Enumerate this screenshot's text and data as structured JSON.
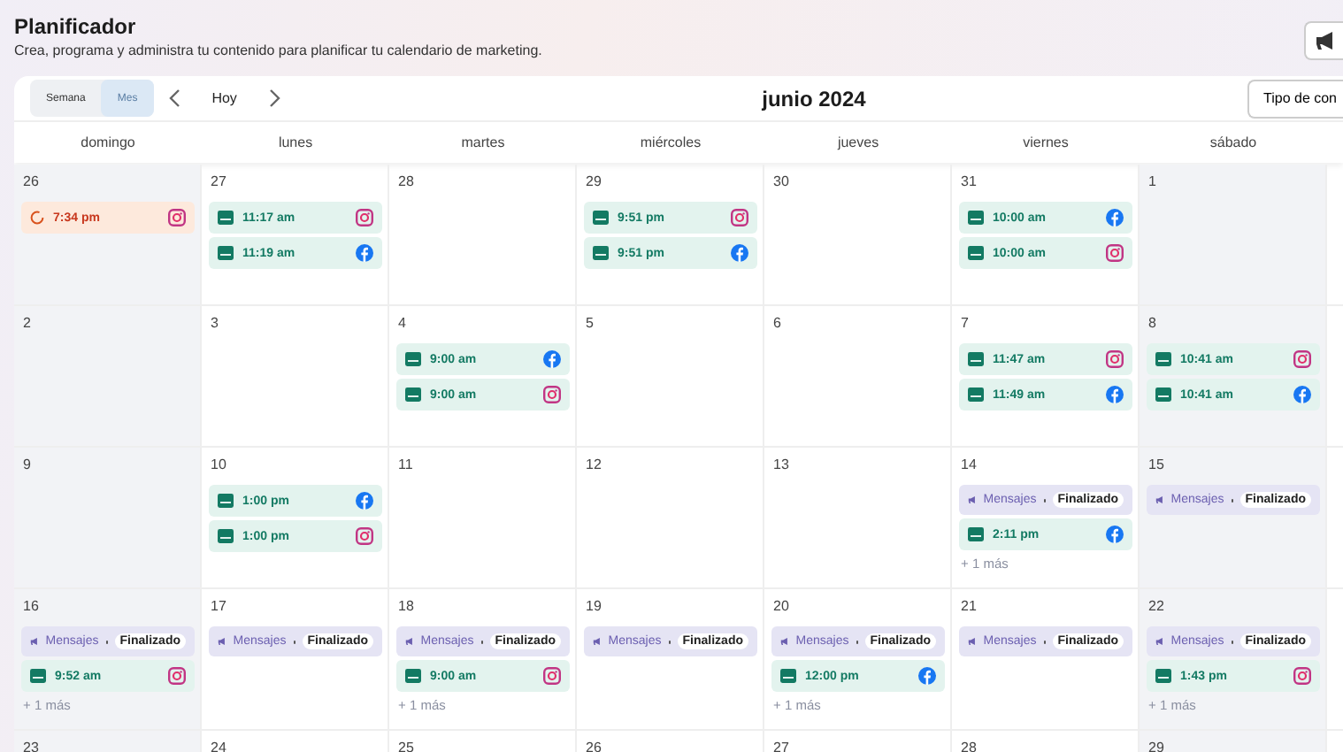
{
  "header": {
    "title": "Planificador",
    "subtitle": "Crea, programa y administra tu contenido para planificar tu calendario de marketing."
  },
  "toolbar": {
    "views": [
      {
        "label": "Semana",
        "selected": false
      },
      {
        "label": "Mes",
        "selected": true
      }
    ],
    "today": "Hoy",
    "month": "junio 2024",
    "filter": "Tipo de con"
  },
  "weekdays": [
    "domingo",
    "lunes",
    "martes",
    "miércoles",
    "jueves",
    "viernes",
    "sábado"
  ],
  "weeks": [
    [
      {
        "day": "26",
        "events": [
          {
            "kind": "instagram",
            "time": "7:34 pm",
            "failed": true
          }
        ]
      },
      {
        "day": "27",
        "events": [
          {
            "kind": "instagram",
            "time": "11:17 am",
            "failed": false
          },
          {
            "kind": "facebook",
            "time": "11:19 am",
            "failed": false
          }
        ]
      },
      {
        "day": "28"
      },
      {
        "day": "29",
        "events": [
          {
            "kind": "instagram",
            "time": "9:51 pm",
            "failed": false
          },
          {
            "kind": "facebook",
            "time": "9:51 pm",
            "failed": false
          }
        ]
      },
      {
        "day": "30"
      },
      {
        "day": "31",
        "events": [
          {
            "kind": "facebook",
            "time": "10:00 am",
            "failed": false
          },
          {
            "kind": "instagram",
            "time": "10:00 am",
            "failed": false
          }
        ]
      },
      {
        "day": "1"
      }
    ],
    [
      {
        "day": "2"
      },
      {
        "day": "3"
      },
      {
        "day": "4",
        "events": [
          {
            "kind": "facebook",
            "time": "9:00 am",
            "failed": false
          },
          {
            "kind": "instagram",
            "time": "9:00 am",
            "failed": false
          }
        ]
      },
      {
        "day": "5"
      },
      {
        "day": "6"
      },
      {
        "day": "7",
        "events": [
          {
            "kind": "instagram",
            "time": "11:47 am",
            "failed": false
          },
          {
            "kind": "facebook",
            "time": "11:49 am",
            "failed": false
          }
        ]
      },
      {
        "day": "8",
        "events": [
          {
            "kind": "instagram",
            "time": "10:41 am",
            "failed": false
          },
          {
            "kind": "facebook",
            "time": "10:41 am",
            "failed": false
          }
        ]
      }
    ],
    [
      {
        "day": "9"
      },
      {
        "day": "10",
        "events": [
          {
            "kind": "facebook",
            "time": "1:00 pm",
            "failed": false
          },
          {
            "kind": "instagram",
            "time": "1:00 pm",
            "failed": false
          }
        ]
      },
      {
        "day": "11"
      },
      {
        "day": "12"
      },
      {
        "day": "13"
      },
      {
        "day": "14",
        "events": [
          {
            "kind": "campaign",
            "label": "Mensajes",
            "status": "Finalizado"
          },
          {
            "kind": "facebook",
            "time": "2:11 pm",
            "failed": false
          },
          {
            "kind": "more",
            "label": "+ 1 más"
          }
        ]
      },
      {
        "day": "15",
        "events": [
          {
            "kind": "campaign",
            "label": "Mensajes",
            "status": "Finalizado"
          }
        ]
      }
    ],
    [
      {
        "day": "16",
        "events": [
          {
            "kind": "campaign",
            "label": "Mensajes",
            "status": "Finalizado"
          },
          {
            "kind": "instagram",
            "time": "9:52 am",
            "failed": false
          },
          {
            "kind": "more",
            "label": "+ 1 más"
          }
        ]
      },
      {
        "day": "17",
        "events": [
          {
            "kind": "campaign",
            "label": "Mensajes",
            "status": "Finalizado"
          }
        ]
      },
      {
        "day": "18",
        "events": [
          {
            "kind": "campaign",
            "label": "Mensajes",
            "status": "Finalizado"
          },
          {
            "kind": "instagram",
            "time": "9:00 am",
            "failed": false
          },
          {
            "kind": "more",
            "label": "+ 1 más"
          }
        ]
      },
      {
        "day": "19",
        "events": [
          {
            "kind": "campaign",
            "label": "Mensajes",
            "status": "Finalizado"
          }
        ]
      },
      {
        "day": "20",
        "events": [
          {
            "kind": "campaign",
            "label": "Mensajes",
            "status": "Finalizado"
          },
          {
            "kind": "facebook",
            "time": "12:00 pm",
            "failed": false
          },
          {
            "kind": "more",
            "label": "+ 1 más"
          }
        ]
      },
      {
        "day": "21",
        "events": [
          {
            "kind": "campaign",
            "label": "Mensajes",
            "status": "Finalizado"
          }
        ]
      },
      {
        "day": "22",
        "events": [
          {
            "kind": "campaign",
            "label": "Mensajes",
            "status": "Finalizado"
          },
          {
            "kind": "instagram",
            "time": "1:43 pm",
            "failed": false
          },
          {
            "kind": "more",
            "label": "+ 1 más"
          }
        ]
      }
    ],
    [
      {
        "day": "23"
      },
      {
        "day": "24"
      },
      {
        "day": "25"
      },
      {
        "day": "26"
      },
      {
        "day": "27"
      },
      {
        "day": "28"
      },
      {
        "day": "29"
      }
    ]
  ]
}
